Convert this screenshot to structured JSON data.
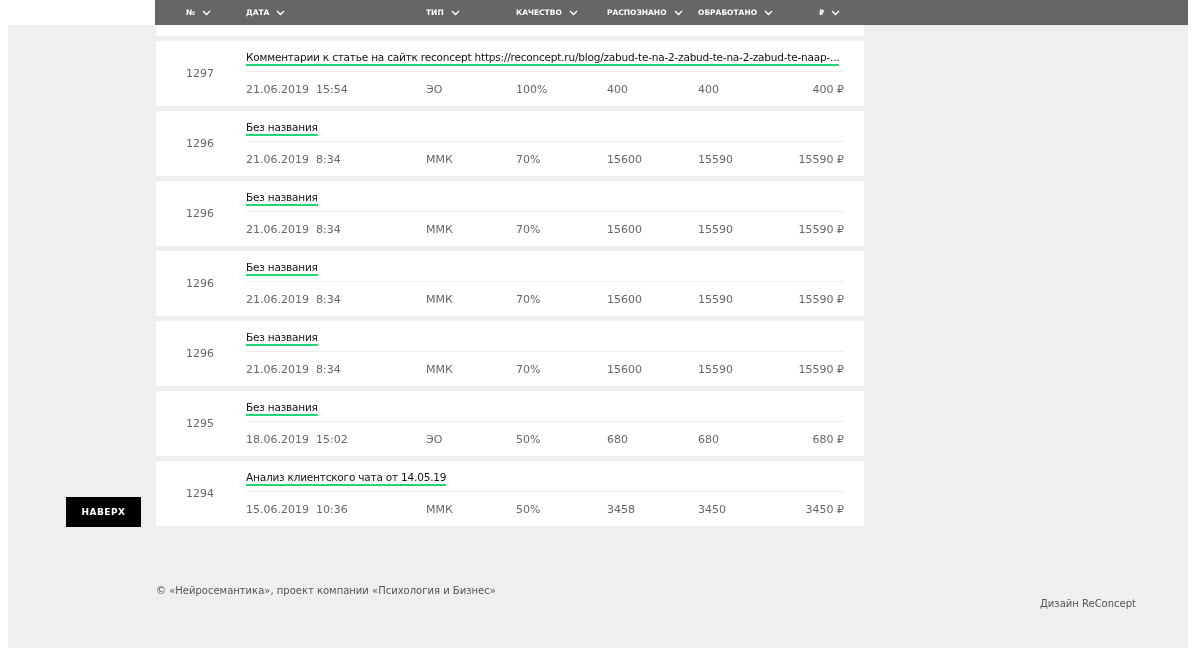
{
  "table": {
    "columns": [
      {
        "label": "№"
      },
      {
        "label": "ДАТА"
      },
      {
        "label": "ТИП"
      },
      {
        "label": "КАЧЕСТВО"
      },
      {
        "label": "РАСПОЗНАНО"
      },
      {
        "label": "ОБРАБОТАНО"
      },
      {
        "label": "₽"
      }
    ],
    "rows": [
      {
        "number": "1297",
        "title": "Комментарии к статье на сайтк reconcept https://reconcept.ru/blog/zabud-te-na-2-zabud-te-na-2-zabud-te-naap-...",
        "date": "21.06.2019",
        "time": "15:54",
        "type": "ЭО",
        "quality": "100%",
        "recognized": "400",
        "processed": "400",
        "price": "400 ₽"
      },
      {
        "number": "1296",
        "title": "Без названия",
        "date": "21.06.2019",
        "time": "8:34",
        "type": "ММК",
        "quality": "70%",
        "recognized": "15600",
        "processed": "15590",
        "price": "15590 ₽"
      },
      {
        "number": "1296",
        "title": "Без названия",
        "date": "21.06.2019",
        "time": "8:34",
        "type": "ММК",
        "quality": "70%",
        "recognized": "15600",
        "processed": "15590",
        "price": "15590 ₽"
      },
      {
        "number": "1296",
        "title": "Без названия",
        "date": "21.06.2019",
        "time": "8:34",
        "type": "ММК",
        "quality": "70%",
        "recognized": "15600",
        "processed": "15590",
        "price": "15590 ₽"
      },
      {
        "number": "1296",
        "title": "Без названия",
        "date": "21.06.2019",
        "time": "8:34",
        "type": "ММК",
        "quality": "70%",
        "recognized": "15600",
        "processed": "15590",
        "price": "15590 ₽"
      },
      {
        "number": "1295",
        "title": "Без названия",
        "date": "18.06.2019",
        "time": "15:02",
        "type": "ЭО",
        "quality": "50%",
        "recognized": "680",
        "processed": "680",
        "price": "680 ₽"
      },
      {
        "number": "1294",
        "title": "Анализ клиентского чата от 14.05.19",
        "date": "15.06.2019",
        "time": "10:36",
        "type": "ММК",
        "quality": "50%",
        "recognized": "3458",
        "processed": "3450",
        "price": "3450 ₽"
      }
    ]
  },
  "scroll_top_button": "НАВЕРХ",
  "footer": {
    "copyright": "© «Нейросемантика», проект компании «Психология и Бизнес»",
    "credit": "Дизайн ReConcept"
  }
}
